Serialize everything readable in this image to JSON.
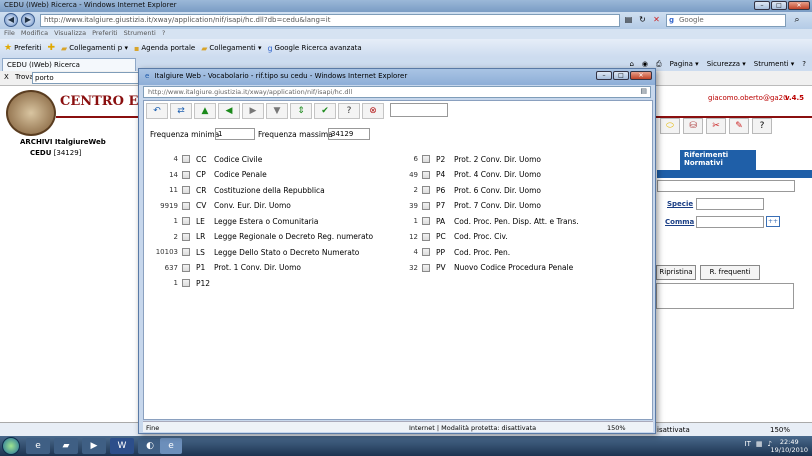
{
  "main_window": {
    "title": "CEDU (IWeb) Ricerca - Windows Internet Explorer",
    "url": "http://www.italgiure.giustizia.it/xway/application/nif/isapi/hc.dll?db=cedu&lang=it",
    "search_placeholder": "Google",
    "menu": [
      "File",
      "Modifica",
      "Visualizza",
      "Preferiti",
      "Strumenti",
      "?"
    ],
    "favorites_bar": [
      "Preferiti",
      "Collegamenti p ▾",
      "Agenda portale",
      "Collegamenti ▾",
      "Google Ricerca avanzata"
    ],
    "tab_label": "CEDU (IWeb) Ricerca",
    "command_bar": [
      "Pagina ▾",
      "Sicurezza ▾",
      "Strumenti ▾"
    ],
    "find_label": "Trova:",
    "find_value": "porto",
    "status_text": "isattivata",
    "zoom": "150%"
  },
  "page": {
    "brand_title": "CENTRO ELI",
    "archive_heading": "ARCHIVI ItalgiureWeb",
    "archive_db": "CEDU",
    "archive_count": "[34129]",
    "user": "giacomo.oberto@ga20",
    "version": "v.4.5",
    "ref_tab": "Riferimenti Normativi",
    "specie_label": "Specie",
    "comma_label": "Comma",
    "plus_label": "++",
    "ripristina_label": "Ripristina",
    "frequenti_label": "R. frequenti"
  },
  "popup": {
    "title": "Italgiure Web - Vocabolario - rif.tipo su cedu - Windows Internet Explorer",
    "url": "http://www.italgiure.giustizia.it/xway/application/nif/isapi/hc.dll",
    "freq_min_label": "Frequenza minima",
    "freq_min_value": "1",
    "freq_max_label": "Frequenza massima",
    "freq_max_value": "34129",
    "status_left": "Fine",
    "status_mid": "Internet | Modalità protetta: disattivata",
    "status_zoom": "150%",
    "left_entries": [
      {
        "count": "4",
        "code": "CC",
        "desc": "Codice Civile"
      },
      {
        "count": "14",
        "code": "CP",
        "desc": "Codice Penale"
      },
      {
        "count": "11",
        "code": "CR",
        "desc": "Costituzione della Repubblica"
      },
      {
        "count": "9919",
        "code": "CV",
        "desc": "Conv. Eur. Dir. Uomo"
      },
      {
        "count": "1",
        "code": "LE",
        "desc": "Legge Estera o Comunitaria"
      },
      {
        "count": "2",
        "code": "LR",
        "desc": "Legge Regionale o Decreto Reg. numerato"
      },
      {
        "count": "10103",
        "code": "LS",
        "desc": "Legge Dello Stato o Decreto Numerato"
      },
      {
        "count": "637",
        "code": "P1",
        "desc": "Prot. 1 Conv. Dir. Uomo"
      },
      {
        "count": "1",
        "code": "P12",
        "desc": ""
      }
    ],
    "right_entries": [
      {
        "count": "6",
        "code": "P2",
        "desc": "Prot. 2 Conv. Dir. Uomo"
      },
      {
        "count": "49",
        "code": "P4",
        "desc": "Prot. 4 Conv. Dir. Uomo"
      },
      {
        "count": "2",
        "code": "P6",
        "desc": "Prot. 6 Conv. Dir. Uomo"
      },
      {
        "count": "39",
        "code": "P7",
        "desc": "Prot. 7 Conv. Dir. Uomo"
      },
      {
        "count": "1",
        "code": "PA",
        "desc": "Cod. Proc. Pen. Disp. Att. e Trans."
      },
      {
        "count": "12",
        "code": "PC",
        "desc": "Cod. Proc. Civ."
      },
      {
        "count": "4",
        "code": "PP",
        "desc": "Cod. Proc. Pen."
      },
      {
        "count": "32",
        "code": "PV",
        "desc": "Nuovo Codice Procedura Penale"
      }
    ]
  },
  "taskbar": {
    "lang": "IT",
    "time": "22:49",
    "date": "19/10/2010"
  },
  "colors": {
    "accent_red": "#8a0f0f",
    "accent_blue": "#1f5fa8"
  }
}
